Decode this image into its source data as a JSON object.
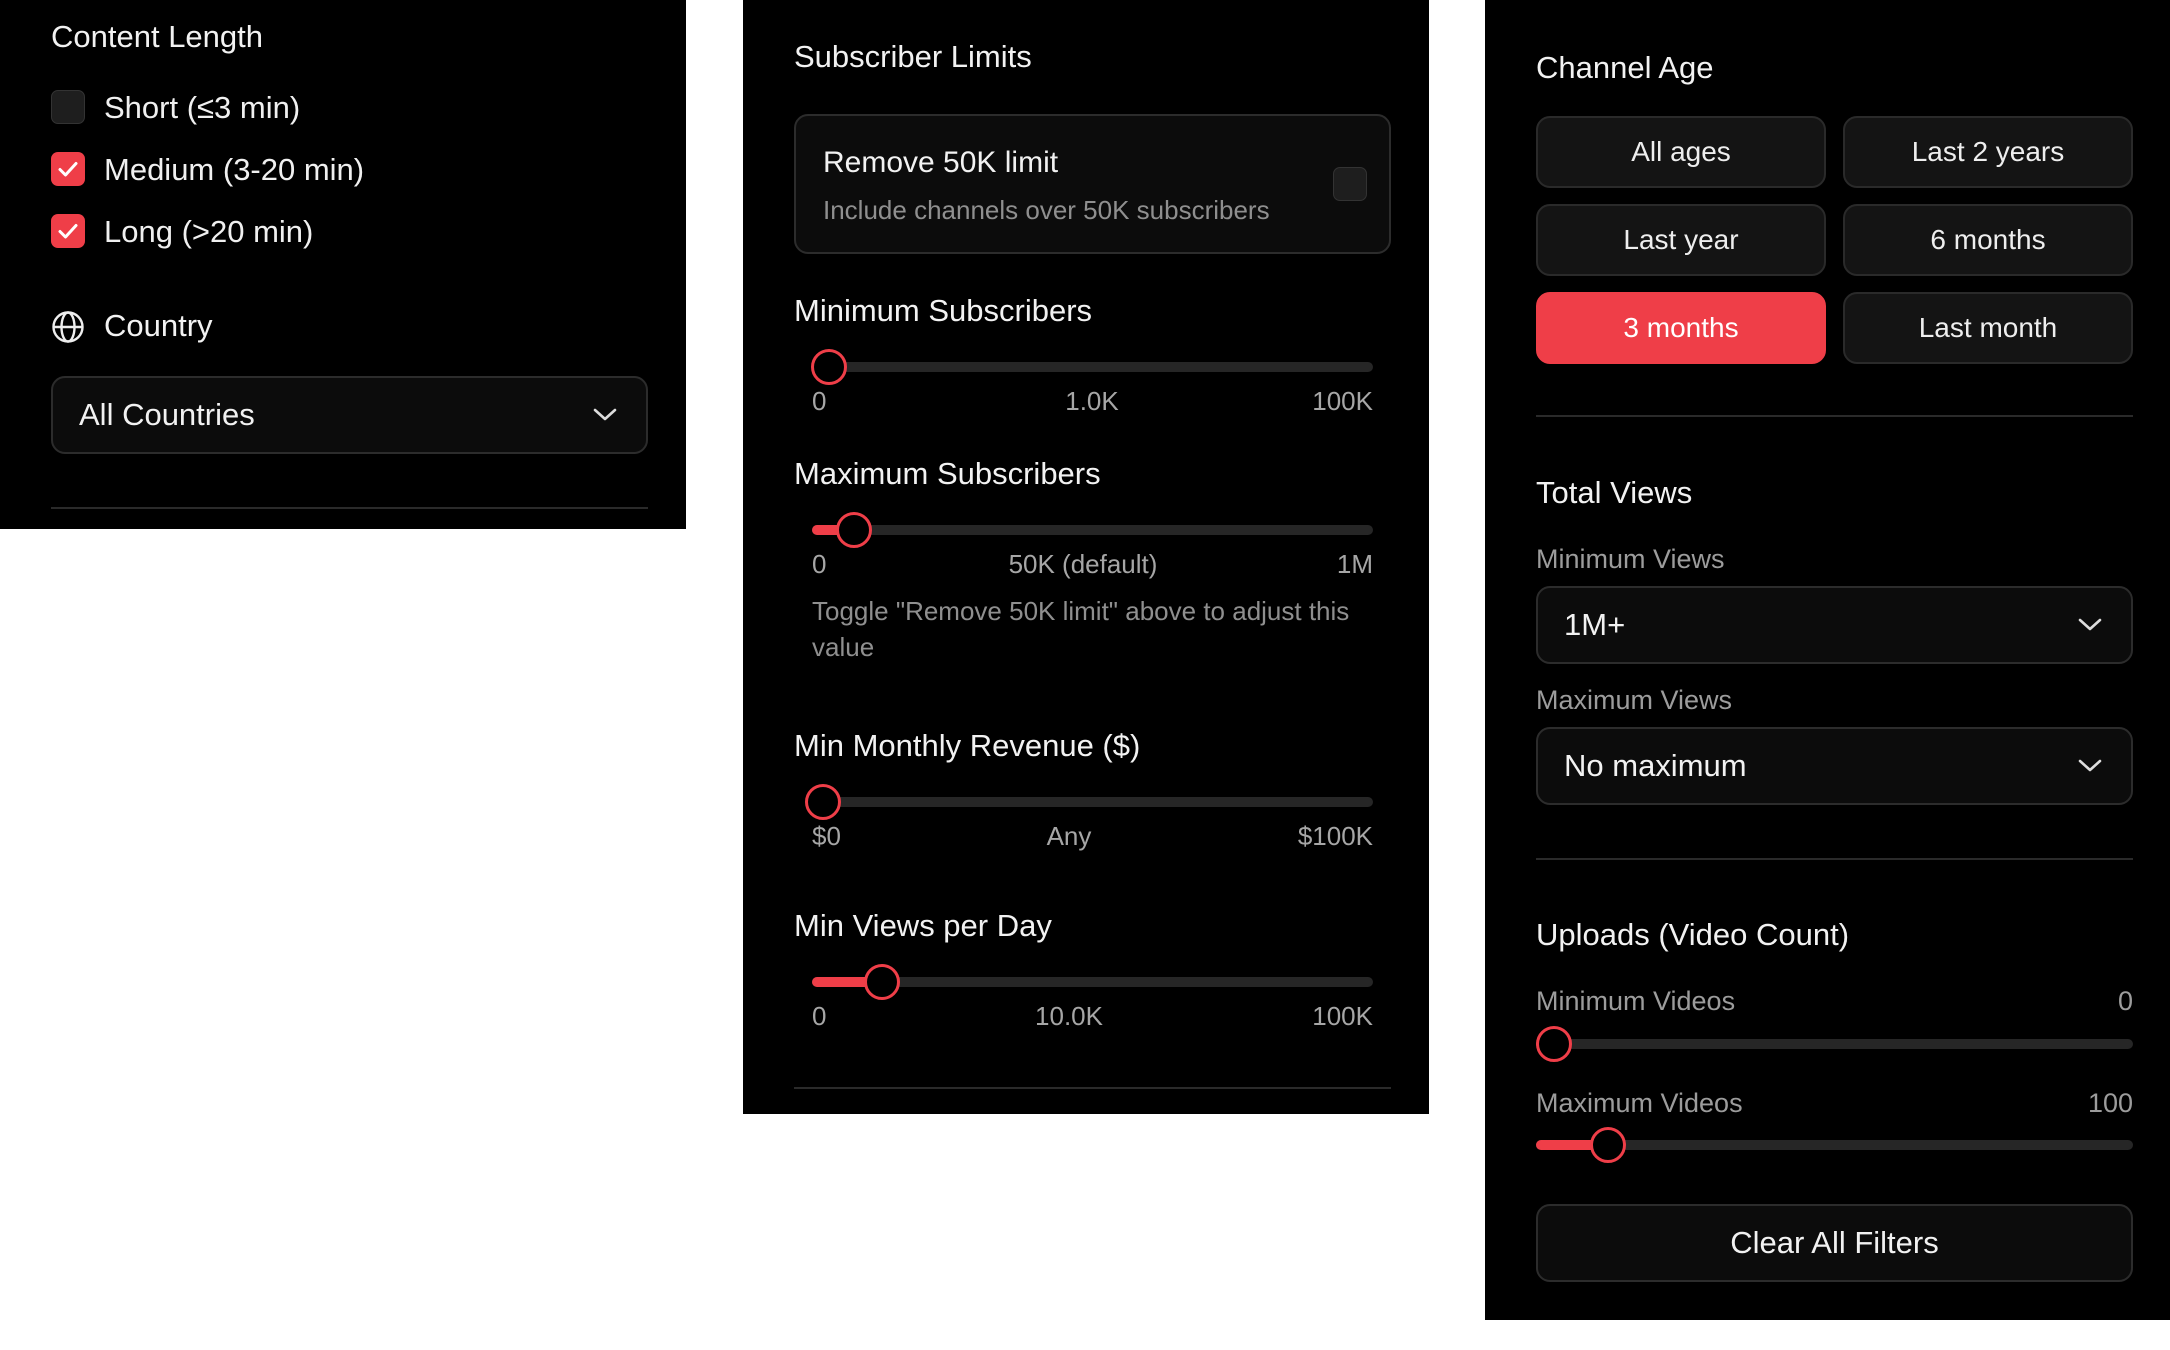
{
  "content_length": {
    "title": "Content Length",
    "options": [
      {
        "label": "Short (≤3 min)",
        "checked": false
      },
      {
        "label": "Medium (3-20 min)",
        "checked": true
      },
      {
        "label": "Long (>20 min)",
        "checked": true
      }
    ]
  },
  "country": {
    "title": "Country",
    "selected": "All Countries",
    "icon": "globe-icon"
  },
  "subscriber_limits": {
    "title": "Subscriber Limits",
    "remove_limit": {
      "title": "Remove 50K limit",
      "description": "Include channels over 50K subscribers",
      "checked": false
    }
  },
  "sliders": {
    "min_subscribers": {
      "title": "Minimum Subscribers",
      "fraction": 0.03,
      "fill": 0.0,
      "ticks": [
        "0",
        "1.0K",
        "100K"
      ]
    },
    "max_subscribers": {
      "title": "Maximum Subscribers",
      "fraction": 0.075,
      "fill": 0.075,
      "ticks": [
        "0",
        "50K (default)",
        "1M"
      ],
      "note": "Toggle \"Remove 50K limit\" above to adjust this value"
    },
    "min_revenue": {
      "title": "Min Monthly Revenue ($)",
      "fraction": 0.02,
      "fill": 0.0,
      "ticks": [
        "$0",
        "Any",
        "$100K"
      ]
    },
    "min_views_per_day": {
      "title": "Min Views per Day",
      "fraction": 0.125,
      "fill": 0.125,
      "ticks": [
        "0",
        "10.0K",
        "100K"
      ]
    }
  },
  "channel_age": {
    "title": "Channel Age",
    "options": [
      "All ages",
      "Last 2 years",
      "Last year",
      "6 months",
      "3 months",
      "Last month"
    ],
    "selected": "3 months"
  },
  "total_views": {
    "title": "Total Views",
    "min_label": "Minimum Views",
    "min_value": "1M+",
    "max_label": "Maximum Views",
    "max_value": "No maximum"
  },
  "uploads": {
    "title": "Uploads (Video Count)",
    "min_label": "Minimum Videos",
    "min_value": "0",
    "min_fraction": 0.03,
    "max_label": "Maximum Videos",
    "max_value": "100",
    "max_fraction": 0.12
  },
  "clear_button": "Clear All Filters",
  "colors": {
    "accent": "#ef3e48",
    "panel": "#000000",
    "track": "#262626"
  }
}
